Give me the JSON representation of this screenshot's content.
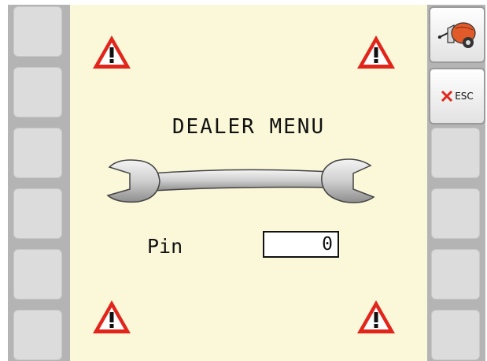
{
  "screen": {
    "title": "DEALER MENU",
    "pin_label": "Pin",
    "pin_value": "0"
  },
  "softkeys": {
    "esc_label": "ESC",
    "esc_icon": "red-x-icon",
    "baler_icon": "round-baler-icon"
  },
  "colors": {
    "screen_bg": "#fbf8d9",
    "warning_red": "#e1251b",
    "frame": "#b4b4b4"
  }
}
